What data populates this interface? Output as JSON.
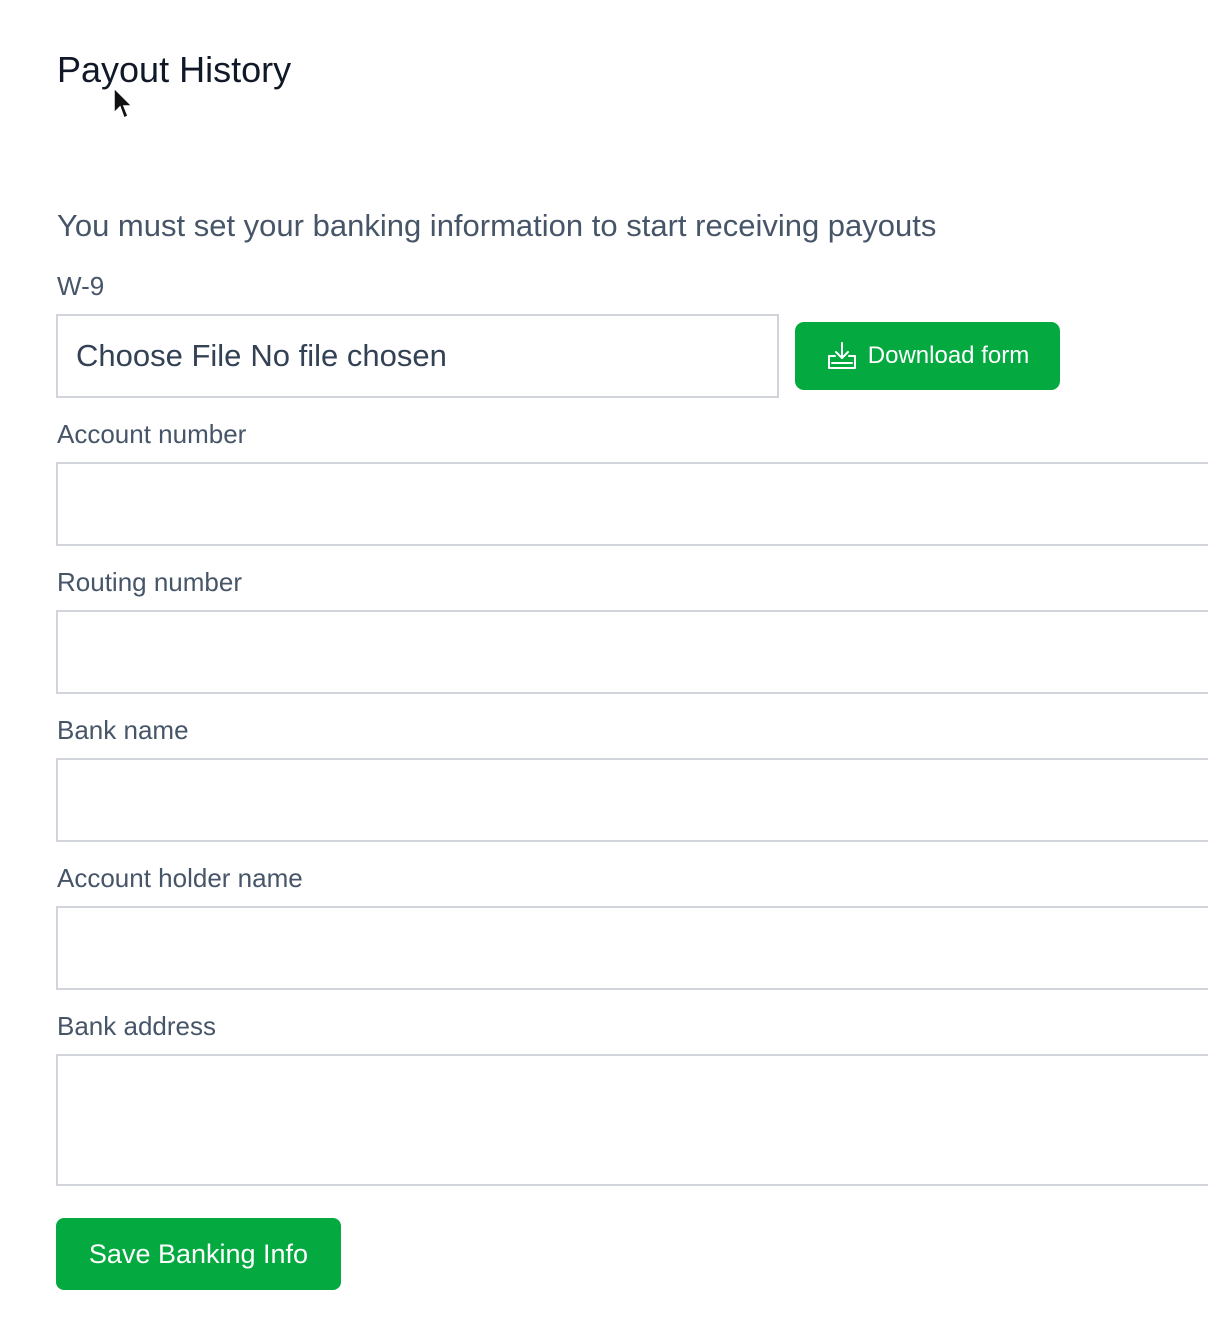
{
  "page": {
    "title": "Payout History",
    "notice": "You must set your banking information to start receiving payouts"
  },
  "form": {
    "w9": {
      "label": "W-9",
      "choose_file_label": "Choose File",
      "file_status": "No file chosen",
      "download_label": "Download form",
      "download_icon": "download-icon"
    },
    "account_number": {
      "label": "Account number",
      "value": ""
    },
    "routing_number": {
      "label": "Routing number",
      "value": ""
    },
    "bank_name": {
      "label": "Bank name",
      "value": ""
    },
    "account_holder_name": {
      "label": "Account holder name",
      "value": ""
    },
    "bank_address": {
      "label": "Bank address",
      "value": ""
    },
    "save_label": "Save Banking Info"
  },
  "colors": {
    "accent": "#04a940",
    "text": "#475569",
    "title": "#111827",
    "border": "#d1d5db"
  }
}
